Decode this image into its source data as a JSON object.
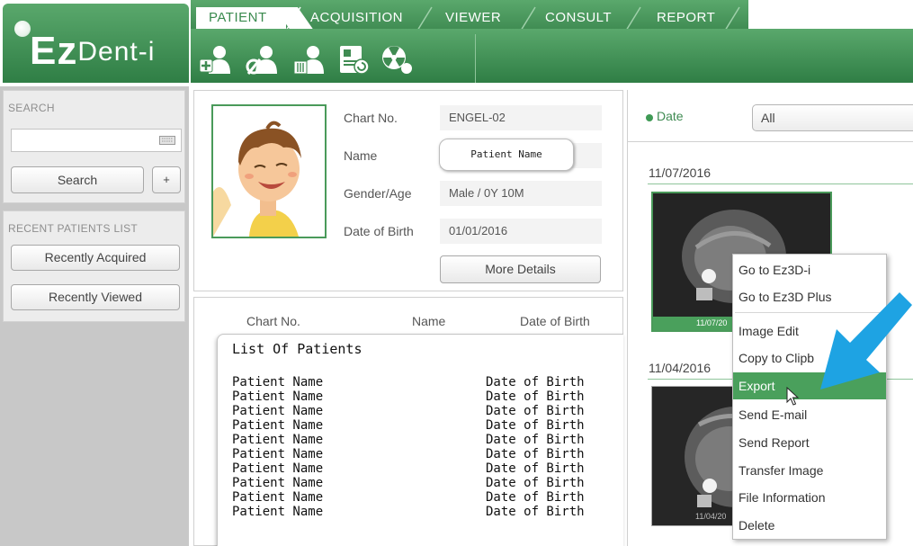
{
  "app": {
    "logo_big": "Ez",
    "logo_rest": "Dent-i"
  },
  "tabs": [
    "PATIENT",
    "ACQUISITION",
    "VIEWER",
    "CONSULT",
    "REPORT"
  ],
  "toolbar_icons": [
    "add-patient-icon",
    "edit-patient-icon",
    "delete-patient-icon",
    "patient-card-icon",
    "radiation-icon"
  ],
  "sidebar": {
    "search_label": "SEARCH",
    "search_value": "",
    "keyboard_icon": "keyboard-icon",
    "search_button": "Search",
    "plus_button": "+",
    "recent_label": "RECENT PATIENTS LIST",
    "recently_acquired": "Recently Acquired",
    "recently_viewed": "Recently Viewed"
  },
  "patient_info": {
    "chart_no_label": "Chart No.",
    "chart_no_value": "ENGEL-02",
    "name_label": "Name",
    "name_value": "Patient Name",
    "gender_age_label": "Gender/Age",
    "gender_age_value": "Male / 0Y 10M",
    "dob_label": "Date of Birth",
    "dob_value": "01/01/2016",
    "more_details": "More Details"
  },
  "patient_list": {
    "headers": [
      "Chart No.",
      "Name",
      "Date of Birth"
    ],
    "title": "List Of Patients",
    "rows": [
      {
        "name": "Patient Name",
        "dob": "Date of Birth"
      },
      {
        "name": "Patient Name",
        "dob": "Date of Birth"
      },
      {
        "name": "Patient Name",
        "dob": "Date of Birth"
      },
      {
        "name": "Patient Name",
        "dob": "Date of Birth"
      },
      {
        "name": "Patient Name",
        "dob": "Date of Birth"
      },
      {
        "name": "Patient Name",
        "dob": "Date of Birth"
      },
      {
        "name": "Patient Name",
        "dob": "Date of Birth"
      },
      {
        "name": "Patient Name",
        "dob": "Date of Birth"
      },
      {
        "name": "Patient Name",
        "dob": "Date of Birth"
      },
      {
        "name": "Patient Name",
        "dob": "Date of Birth"
      }
    ]
  },
  "images": {
    "filter_label": "Date",
    "filter_value": "All",
    "groups": [
      {
        "date": "11/07/2016",
        "thumb_caption": "11/07/20"
      },
      {
        "date": "11/04/2016",
        "thumb_caption": "11/04/20"
      }
    ]
  },
  "context_menu": {
    "items": [
      "Go to Ez3D-i",
      "Go to Ez3D Plus",
      "Image Edit",
      "Copy to Clipb",
      "Export",
      "Send E-mail",
      "Send Report",
      "Transfer Image",
      "File Information",
      "Delete"
    ],
    "highlighted": "Export"
  },
  "colors": {
    "brand_green": "#3f8b52",
    "highlight_green": "#4aa05c",
    "arrow_blue": "#1ea3e3"
  }
}
